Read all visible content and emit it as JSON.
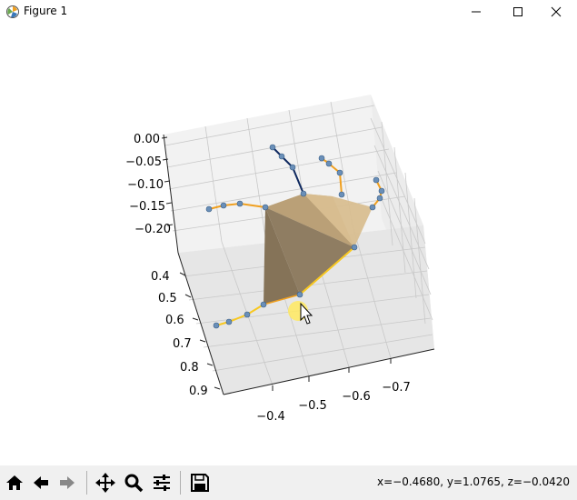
{
  "window": {
    "title": "Figure 1"
  },
  "axes": {
    "z_ticks": [
      "0.00",
      "−0.05",
      "−0.10",
      "−0.15",
      "−0.20"
    ],
    "y_ticks": [
      "0.4",
      "0.5",
      "0.6",
      "0.7",
      "0.8",
      "0.9"
    ],
    "x_ticks": [
      "−0.4",
      "−0.5",
      "−0.6",
      "−0.7"
    ]
  },
  "toolbar": {
    "buttons": [
      "home-icon",
      "back-icon",
      "forward-icon",
      "pan-icon",
      "zoom-icon",
      "configure-icon",
      "save-icon"
    ],
    "coords": "x=−0.4680, y=1.0765, z=−0.0420"
  },
  "colors": {
    "polygon": "#8a7a60",
    "polygon_light": "#cdb48c",
    "orange": "#f0a020",
    "yellow": "#f8c820",
    "navy": "#102a60",
    "joint": "#6a8fb8",
    "highlight": "#ffe960"
  }
}
